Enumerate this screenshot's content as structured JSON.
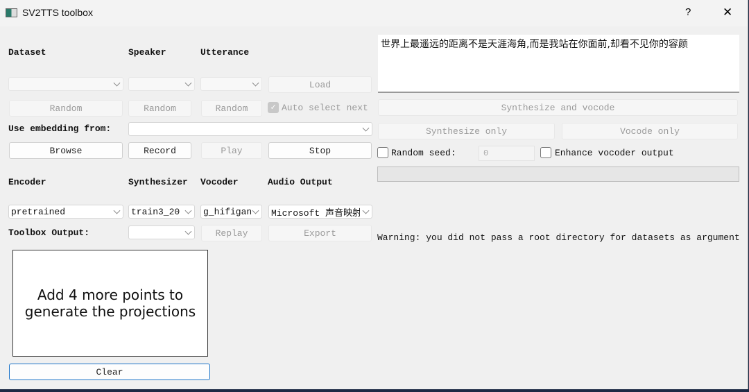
{
  "window": {
    "title": "SV2TTS toolbox",
    "help": "?",
    "close": "✕"
  },
  "dataset": {
    "labels": {
      "dataset": "Dataset",
      "speaker": "Speaker",
      "utterance": "Utterance"
    },
    "load": "Load",
    "random": "Random",
    "auto_select_next": "Auto select next",
    "auto_select_checked": true
  },
  "embedding": {
    "label": "Use embedding from:",
    "browse": "Browse",
    "record": "Record",
    "play": "Play",
    "stop": "Stop"
  },
  "models": {
    "labels": {
      "encoder": "Encoder",
      "synthesizer": "Synthesizer",
      "vocoder": "Vocoder",
      "audio_output": "Audio Output"
    },
    "encoder": "pretrained",
    "synthesizer": "train3_20",
    "vocoder": "g_hifigan",
    "audio_output": "Microsoft 声音映射"
  },
  "toolbox_output": {
    "label": "Toolbox Output:",
    "replay": "Replay",
    "export": "Export"
  },
  "projection": {
    "message": "Add 4 more points to generate the projections",
    "clear": "Clear"
  },
  "synthesis": {
    "text": "世界上最遥远的距离不是天涯海角,而是我站在你面前,却看不见你的容颜",
    "synth_and_vocode": "Synthesize and vocode",
    "synth_only": "Synthesize only",
    "vocode_only": "Vocode only",
    "random_seed": "Random seed:",
    "seed_value": "0",
    "enhance": "Enhance vocoder output",
    "progress": 0
  },
  "log": {
    "warning": "Warning: you did not pass a root directory for datasets as argument"
  }
}
